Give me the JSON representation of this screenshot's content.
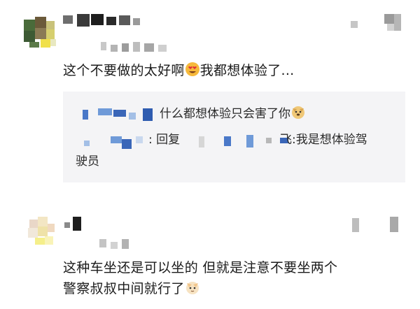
{
  "comments": [
    {
      "text_before": "这个不要做的太好啊",
      "emoji_1": "heart-eyes-emoji",
      "text_after": "我都想体验了...",
      "replies": [
        {
          "text": "什么都想体验只会害了你",
          "emoji": "doge-emoji"
        },
        {
          "text_a": ": 回复",
          "text_b": "飞:我是想体验驾",
          "text_c": "驶员"
        }
      ]
    },
    {
      "line1": "这种车坐还是可以坐的 但就是注意不要坐两个",
      "line2": "警察叔叔中间就行了",
      "emoji": "cat-emoji"
    }
  ],
  "colors": {
    "reply_bg": "#f4f4f6",
    "text": "#1b1b1b"
  }
}
